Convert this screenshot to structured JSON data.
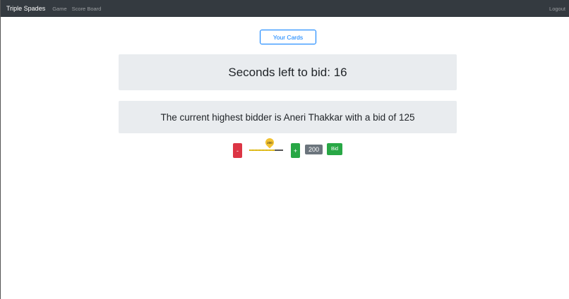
{
  "navbar": {
    "brand": "Triple Spades",
    "links": [
      {
        "label": "Game"
      },
      {
        "label": "Score Board"
      }
    ],
    "logout_label": "Logout"
  },
  "main": {
    "your_cards_label": "Your Cards",
    "timer_text": "Seconds left to bid: 16",
    "bidder_text": "The current highest bidder is Aneri Thakkar with a bid of 125"
  },
  "bid_controls": {
    "minus_label": "-",
    "plus_label": "+",
    "slider_value": "200",
    "current_bid": "200",
    "bid_button_label": "Bid"
  },
  "colors": {
    "navbar_bg": "#343a40",
    "primary": "#007bff",
    "danger": "#dc3545",
    "success": "#28a745",
    "secondary": "#6c757d",
    "panel_bg": "#e9ecef",
    "slider_accent": "#f2c230"
  }
}
